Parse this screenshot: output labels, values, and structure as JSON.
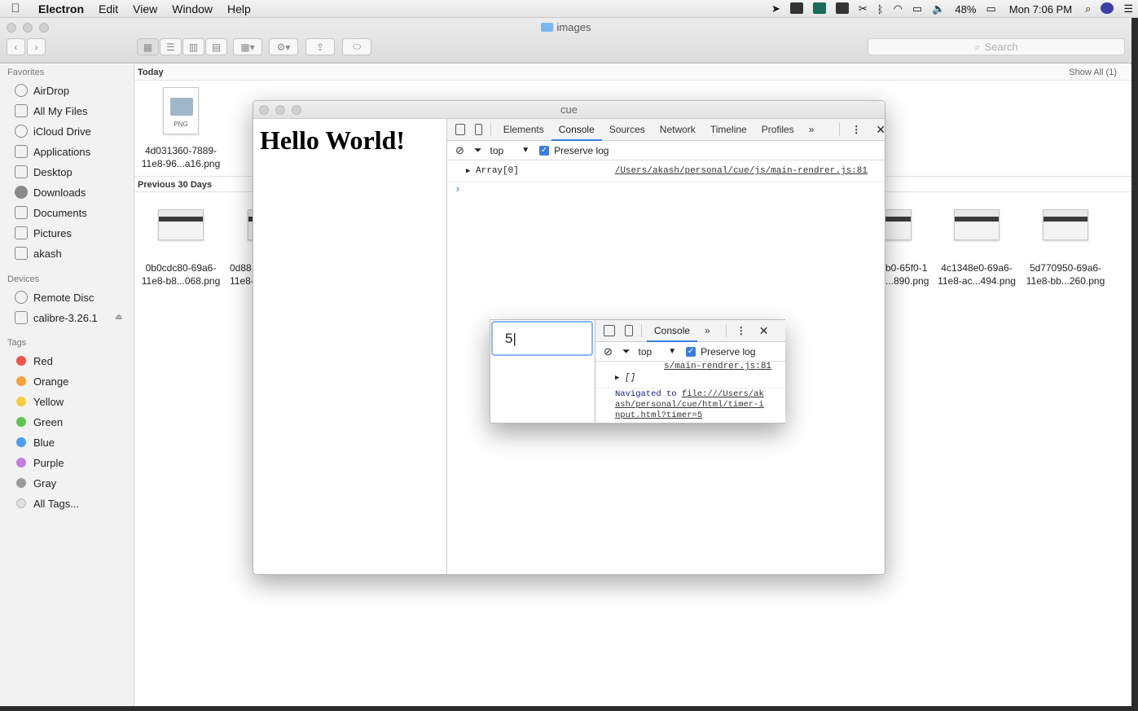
{
  "menubar": {
    "app_name": "Electron",
    "items": [
      "Edit",
      "View",
      "Window",
      "Help"
    ],
    "battery": "48%",
    "clock": "Mon 7:06 PM"
  },
  "finder": {
    "title": "images",
    "search_placeholder": "Search",
    "sidebar": {
      "favorites_header": "Favorites",
      "favorites": [
        "AirDrop",
        "All My Files",
        "iCloud Drive",
        "Applications",
        "Desktop",
        "Downloads",
        "Documents",
        "Pictures",
        "akash"
      ],
      "devices_header": "Devices",
      "devices": [
        "Remote Disc",
        "calibre-3.26.1"
      ],
      "tags_header": "Tags",
      "tags": [
        {
          "label": "Red",
          "color": "#f0524a"
        },
        {
          "label": "Orange",
          "color": "#f5a13b"
        },
        {
          "label": "Yellow",
          "color": "#f6cd3e"
        },
        {
          "label": "Green",
          "color": "#5fc351"
        },
        {
          "label": "Blue",
          "color": "#4c9ff3"
        },
        {
          "label": "Purple",
          "color": "#c27ee0"
        },
        {
          "label": "Gray",
          "color": "#9b9b9b"
        },
        {
          "label": "All Tags...",
          "color": "#e0e0e0"
        }
      ]
    },
    "sections": {
      "today": "Today",
      "show_all": "Show All (1)",
      "previous": "Previous 30 Days"
    },
    "files_today": [
      {
        "line1": "4d031360-7889-",
        "line2": "11e8-96...a16.png",
        "badge": "PNG"
      }
    ],
    "files_previous": [
      {
        "line1": "0b0cdc80-69a6-",
        "line2": "11e8-b8...068.png"
      },
      {
        "line1": "0d88",
        "line2": "11e8-"
      },
      {
        "line1": "b0-65f0-1",
        "line2": "...890.png"
      },
      {
        "line1": "4c1348e0-69a6-",
        "line2": "11e8-ac...494.png"
      },
      {
        "line1": "5d770950-69a6-",
        "line2": "11e8-bb...260.png"
      }
    ]
  },
  "cue_window": {
    "title": "cue",
    "page_heading": "Hello World!",
    "devtools": {
      "tabs": [
        "Elements",
        "Console",
        "Sources",
        "Network",
        "Timeline",
        "Profiles"
      ],
      "active_tab": "Console",
      "more": "»",
      "context": "top",
      "preserve_log": "Preserve log",
      "log_entry": "Array[0]",
      "log_source": "/Users/akash/personal/cue/js/main-rendrer.js:81",
      "prompt": "›"
    }
  },
  "timer_window": {
    "input_value": "5",
    "devtools": {
      "tab": "Console",
      "more": "»",
      "context": "top",
      "preserve_log": "Preserve log",
      "source_fragment": "s/main-rendrer.js:81",
      "array_entry": "[]",
      "navigated_label": "Navigated to",
      "navigated_url_1": "file:///Users/ak",
      "navigated_url_2": "ash/personal/cue/html/timer-i",
      "navigated_url_3": "nput.html?timer=5"
    }
  }
}
